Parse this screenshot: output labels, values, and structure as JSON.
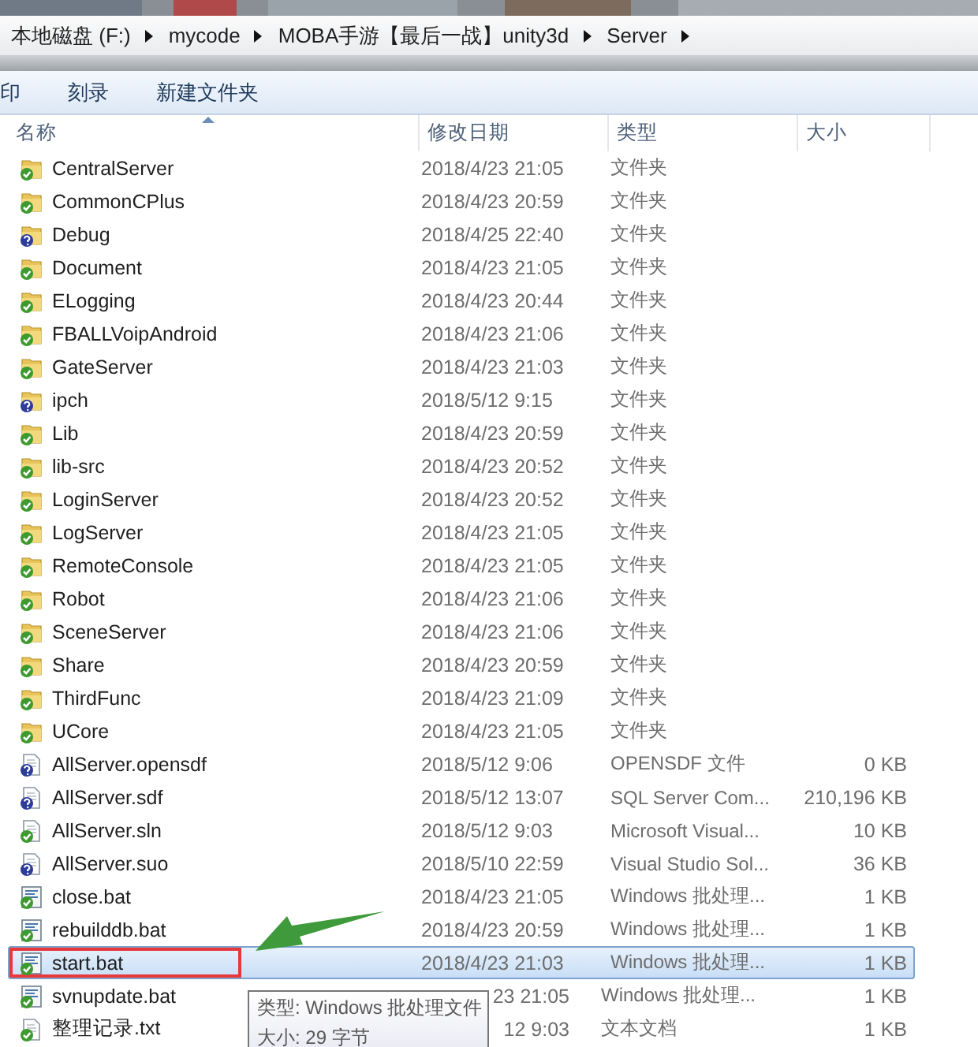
{
  "breadcrumb": [
    "本地磁盘 (F:)",
    "mycode",
    "MOBA手游【最后一战】unity3d",
    "Server"
  ],
  "toolbar": [
    "印",
    "刻录",
    "新建文件夹"
  ],
  "columns": [
    "名称",
    "修改日期",
    "类型",
    "大小"
  ],
  "rows": [
    {
      "name": "CentralServer",
      "date": "2018/4/23 21:05",
      "type": "文件夹",
      "kind": "folder",
      "versioned": true,
      "selected": false,
      "boxed": false,
      "covered": false
    },
    {
      "name": "CommonCPlus",
      "date": "2018/4/23 20:59",
      "type": "文件夹",
      "kind": "folder",
      "versioned": true,
      "selected": false,
      "boxed": false,
      "covered": false
    },
    {
      "name": "Debug",
      "date": "2018/4/25 22:40",
      "type": "文件夹",
      "kind": "folder",
      "versioned": false,
      "selected": false,
      "boxed": false,
      "covered": false
    },
    {
      "name": "Document",
      "date": "2018/4/23 21:05",
      "type": "文件夹",
      "kind": "folder",
      "versioned": true,
      "selected": false,
      "boxed": false,
      "covered": false
    },
    {
      "name": "ELogging",
      "date": "2018/4/23 20:44",
      "type": "文件夹",
      "kind": "folder",
      "versioned": true,
      "selected": false,
      "boxed": false,
      "covered": false
    },
    {
      "name": "FBALLVoipAndroid",
      "date": "2018/4/23 21:06",
      "type": "文件夹",
      "kind": "folder",
      "versioned": true,
      "selected": false,
      "boxed": false,
      "covered": false
    },
    {
      "name": "GateServer",
      "date": "2018/4/23 21:03",
      "type": "文件夹",
      "kind": "folder",
      "versioned": true,
      "selected": false,
      "boxed": false,
      "covered": false
    },
    {
      "name": "ipch",
      "date": "2018/5/12 9:15",
      "type": "文件夹",
      "kind": "folder",
      "versioned": false,
      "selected": false,
      "boxed": false,
      "covered": false
    },
    {
      "name": "Lib",
      "date": "2018/4/23 20:59",
      "type": "文件夹",
      "kind": "folder",
      "versioned": true,
      "selected": false,
      "boxed": false,
      "covered": false
    },
    {
      "name": "lib-src",
      "date": "2018/4/23 20:52",
      "type": "文件夹",
      "kind": "folder",
      "versioned": true,
      "selected": false,
      "boxed": false,
      "covered": false
    },
    {
      "name": "LoginServer",
      "date": "2018/4/23 20:52",
      "type": "文件夹",
      "kind": "folder",
      "versioned": true,
      "selected": false,
      "boxed": false,
      "covered": false
    },
    {
      "name": "LogServer",
      "date": "2018/4/23 21:05",
      "type": "文件夹",
      "kind": "folder",
      "versioned": true,
      "selected": false,
      "boxed": false,
      "covered": false
    },
    {
      "name": "RemoteConsole",
      "date": "2018/4/23 21:05",
      "type": "文件夹",
      "kind": "folder",
      "versioned": true,
      "selected": false,
      "boxed": false,
      "covered": false
    },
    {
      "name": "Robot",
      "date": "2018/4/23 21:06",
      "type": "文件夹",
      "kind": "folder",
      "versioned": true,
      "selected": false,
      "boxed": false,
      "covered": false
    },
    {
      "name": "SceneServer",
      "date": "2018/4/23 21:06",
      "type": "文件夹",
      "kind": "folder",
      "versioned": true,
      "selected": false,
      "boxed": false,
      "covered": false
    },
    {
      "name": "Share",
      "date": "2018/4/23 20:59",
      "type": "文件夹",
      "kind": "folder",
      "versioned": true,
      "selected": false,
      "boxed": false,
      "covered": false
    },
    {
      "name": "ThirdFunc",
      "date": "2018/4/23 21:09",
      "type": "文件夹",
      "kind": "folder",
      "versioned": true,
      "selected": false,
      "boxed": false,
      "covered": false
    },
    {
      "name": "UCore",
      "date": "2018/4/23 21:05",
      "type": "文件夹",
      "kind": "folder",
      "versioned": true,
      "selected": false,
      "boxed": false,
      "covered": false
    },
    {
      "name": "AllServer.opensdf",
      "date": "2018/5/12 9:06",
      "type": "OPENSDF 文件",
      "size": "0 KB",
      "kind": "file",
      "versioned": false,
      "selected": false,
      "boxed": false,
      "covered": false
    },
    {
      "name": "AllServer.sdf",
      "date": "2018/5/12 13:07",
      "type": "SQL Server Com...",
      "size": "210,196 KB",
      "kind": "file",
      "versioned": false,
      "selected": false,
      "boxed": false,
      "covered": false
    },
    {
      "name": "AllServer.sln",
      "date": "2018/5/12 9:03",
      "type": "Microsoft Visual...",
      "size": "10 KB",
      "kind": "file",
      "versioned": true,
      "selected": false,
      "boxed": false,
      "covered": false
    },
    {
      "name": "AllServer.suo",
      "date": "2018/5/10 22:59",
      "type": "Visual Studio Sol...",
      "size": "36 KB",
      "kind": "file",
      "versioned": false,
      "selected": false,
      "boxed": false,
      "covered": false
    },
    {
      "name": "close.bat",
      "date": "2018/4/23 21:05",
      "type": "Windows 批处理...",
      "size": "1 KB",
      "kind": "bat",
      "versioned": true,
      "selected": false,
      "boxed": false,
      "covered": false
    },
    {
      "name": "rebuilddb.bat",
      "date": "2018/4/23 20:59",
      "type": "Windows 批处理...",
      "size": "1 KB",
      "kind": "bat",
      "versioned": true,
      "selected": false,
      "boxed": false,
      "covered": false
    },
    {
      "name": "start.bat",
      "date": "2018/4/23 21:03",
      "type": "Windows 批处理...",
      "size": "1 KB",
      "kind": "bat",
      "versioned": true,
      "selected": true,
      "boxed": true,
      "covered": false
    },
    {
      "name": "svnupdate.bat",
      "date": "23 21:05",
      "type": "Windows 批处理...",
      "size": "1 KB",
      "kind": "bat",
      "versioned": true,
      "selected": false,
      "boxed": false,
      "covered": true
    },
    {
      "name": "整理记录.txt",
      "date": "12 9:03",
      "type": "文本文档",
      "size": "1 KB",
      "kind": "file",
      "versioned": true,
      "selected": false,
      "boxed": false,
      "covered": true
    }
  ],
  "tooltip": [
    "类型: Windows 批处理文件",
    "大小: 29 字节"
  ]
}
